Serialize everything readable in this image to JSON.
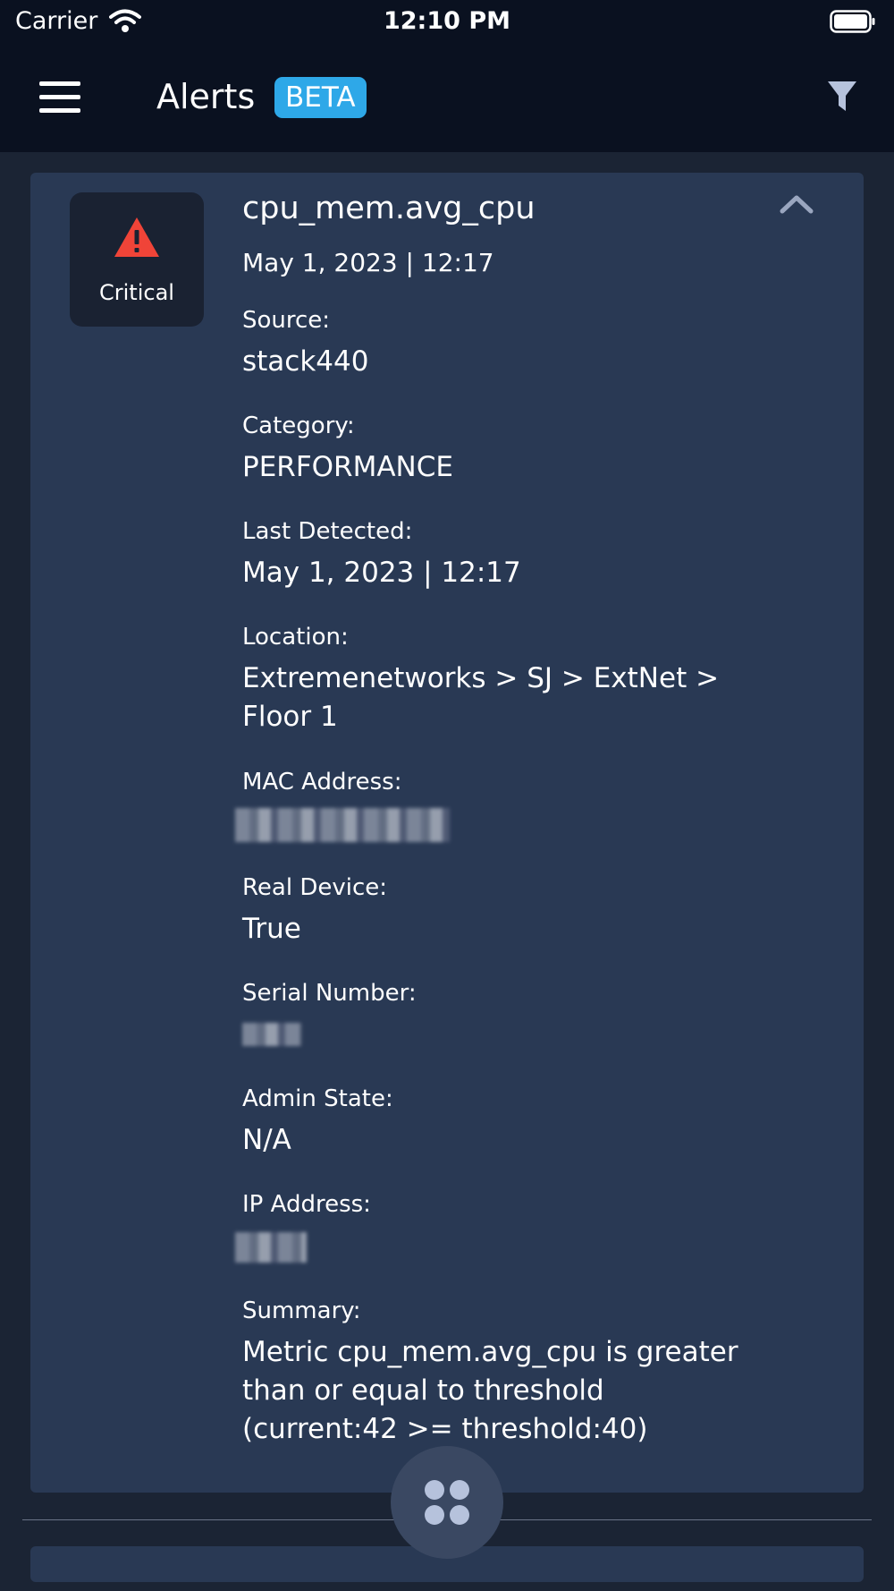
{
  "status_bar": {
    "carrier": "Carrier",
    "time": "12:10 PM"
  },
  "header": {
    "title": "Alerts",
    "badge": "BETA"
  },
  "alert": {
    "severity": "Critical",
    "title": "cpu_mem.avg_cpu",
    "date": "May 1, 2023 | 12:17",
    "fields": {
      "source_label": "Source:",
      "source": "stack440",
      "category_label": "Category:",
      "category": "PERFORMANCE",
      "last_detected_label": "Last Detected:",
      "last_detected": "May 1, 2023 | 12:17",
      "location_label": "Location:",
      "location": "Extremenetworks > SJ > ExtNet > Floor 1",
      "mac_label": "MAC Address:",
      "real_device_label": "Real Device:",
      "real_device": "True",
      "serial_label": "Serial Number:",
      "admin_state_label": "Admin State:",
      "admin_state": "N/A",
      "ip_label": "IP Address:",
      "summary_label": "Summary:",
      "summary": "Metric cpu_mem.avg_cpu is greater than or equal to threshold (current:42 >= threshold:40)"
    }
  },
  "colors": {
    "background": "#1b2434",
    "card": "#293954",
    "accent": "#2ea8e8",
    "critical": "#f04438"
  },
  "icons": [
    "wifi-icon",
    "battery-icon",
    "hamburger-menu-icon",
    "filter-icon",
    "warning-icon",
    "chevron-up-icon",
    "apps-grid-icon"
  ]
}
